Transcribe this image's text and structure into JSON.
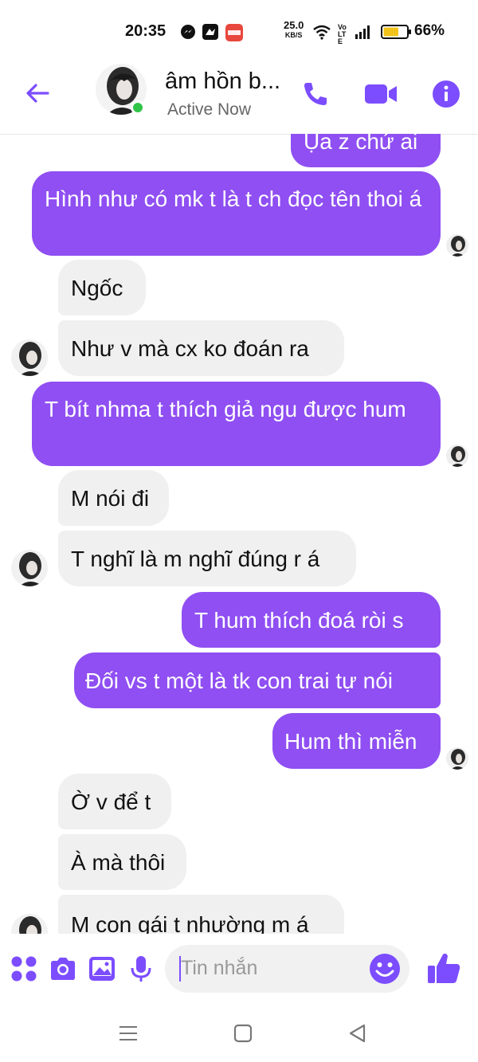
{
  "status_bar": {
    "time": "20:35",
    "net_speed_value": "25.0",
    "net_speed_unit": "KB/S",
    "volte": "Vo LTE",
    "battery_percent": "66%",
    "battery_level": 0.66
  },
  "header": {
    "contact_name": "âm hồn b...",
    "status": "Active Now"
  },
  "messages": [
    {
      "dir": "out",
      "text": "Ụa z chứ ai"
    },
    {
      "dir": "out",
      "text": "Hình như có mk t là t ch đọc tên thoi á"
    },
    {
      "dir": "in",
      "text": "Ngốc"
    },
    {
      "dir": "in",
      "text": "Như v mà cx ko đoán ra"
    },
    {
      "dir": "out",
      "text": "T bít nhma t thích giả ngu được hum"
    },
    {
      "dir": "in",
      "text": "M nói đi"
    },
    {
      "dir": "in",
      "text": "T nghĩ là m nghĩ đúng r á"
    },
    {
      "dir": "out",
      "text": "T hum thích đoá ròi s"
    },
    {
      "dir": "out",
      "text": "Đối vs t một là tk con trai tự nói"
    },
    {
      "dir": "out",
      "text": "Hum thì miễn"
    },
    {
      "dir": "in",
      "text": "Ờ v để t"
    },
    {
      "dir": "in",
      "text": "À mà thôi"
    },
    {
      "dir": "in",
      "text": "M con gái t nhường m á"
    }
  ],
  "composer": {
    "placeholder": "Tin nhắn"
  },
  "colors": {
    "accent": "#7c4dff",
    "outgoing_bubble": "#8f4ff2",
    "incoming_bubble": "#f0f0f0",
    "online": "#31c548"
  }
}
